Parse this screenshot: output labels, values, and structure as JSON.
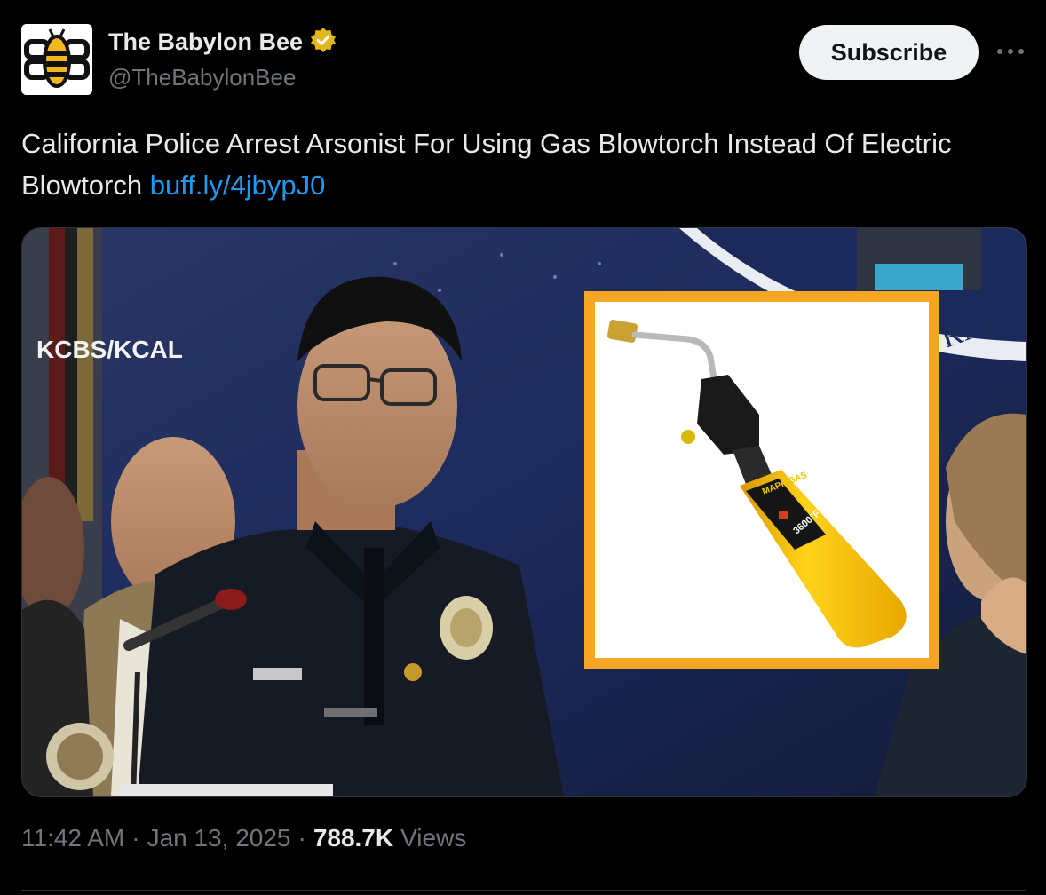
{
  "account": {
    "display_name": "The Babylon Bee",
    "handle": "@TheBabylonBee",
    "verified_icon": "verified-badge-icon",
    "verified_color": "#e2b719"
  },
  "actions": {
    "subscribe_label": "Subscribe",
    "more_icon": "more-icon"
  },
  "tweet": {
    "text": "California Police Arrest Arsonist For Using Gas Blowtorch Instead Of Electric Blowtorch",
    "link_text": "buff.ly/4jbypJ0",
    "link_color": "#1d9bf0"
  },
  "media": {
    "watermark": "KCBS/KCAL",
    "inset_frame_color": "#f6a623",
    "can_label": "MAPP GAS",
    "can_temp": "3600°F"
  },
  "meta": {
    "time": "11:42 AM",
    "separator1": "·",
    "date": "Jan 13, 2025",
    "separator2": "·",
    "views_count": "788.7K",
    "views_label": "Views"
  }
}
